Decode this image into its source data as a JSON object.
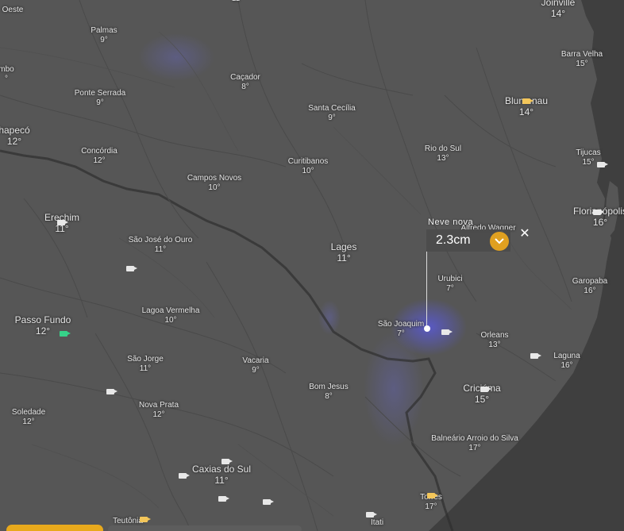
{
  "cities": [
    {
      "id": "oeste",
      "name": "Oeste",
      "temp": ""
    },
    {
      "id": "top-partial",
      "name": "",
      "temp": "11"
    },
    {
      "id": "joinville",
      "name": "Joinville",
      "temp": "14°"
    },
    {
      "id": "palmas",
      "name": "Palmas",
      "temp": "9°"
    },
    {
      "id": "xanxere-partial",
      "name": "mbo",
      "temp": "°"
    },
    {
      "id": "cacador",
      "name": "Caçador",
      "temp": "8°"
    },
    {
      "id": "barra-velha",
      "name": "Barra Velha",
      "temp": "15°"
    },
    {
      "id": "ponte-serrada",
      "name": "Ponte Serrada",
      "temp": "9°"
    },
    {
      "id": "blumenau",
      "name": "Blumenau",
      "temp": "14°"
    },
    {
      "id": "santa-cecilia",
      "name": "Santa Cecília",
      "temp": "9°"
    },
    {
      "id": "chapeco",
      "name": "hapecó",
      "temp": "12°"
    },
    {
      "id": "concordia",
      "name": "Concórdia",
      "temp": "12°"
    },
    {
      "id": "rio-do-sul",
      "name": "Rio do Sul",
      "temp": "13°"
    },
    {
      "id": "tijucas",
      "name": "Tijucas",
      "temp": "15°"
    },
    {
      "id": "curitibanos",
      "name": "Curitibanos",
      "temp": "10°"
    },
    {
      "id": "campos-novos",
      "name": "Campos Novos",
      "temp": "10°"
    },
    {
      "id": "florianopolis",
      "name": "Florianópolis",
      "temp": "16°"
    },
    {
      "id": "erechim",
      "name": "Erechim",
      "temp": "11°"
    },
    {
      "id": "alfredo-wagner",
      "name": "Alfredo Wagner",
      "temp": ""
    },
    {
      "id": "sao-jose-do-ouro",
      "name": "São José do Ouro",
      "temp": "11°"
    },
    {
      "id": "lages",
      "name": "Lages",
      "temp": "11°"
    },
    {
      "id": "urubici",
      "name": "Urubici",
      "temp": "7°"
    },
    {
      "id": "garopaba",
      "name": "Garopaba",
      "temp": "16°"
    },
    {
      "id": "lagoa-vermelha",
      "name": "Lagoa Vermelha",
      "temp": "10°"
    },
    {
      "id": "passo-fundo",
      "name": "Passo Fundo",
      "temp": "12°"
    },
    {
      "id": "sao-joaquim",
      "name": "São Joaquim",
      "temp": "7°"
    },
    {
      "id": "orleans",
      "name": "Orleans",
      "temp": "13°"
    },
    {
      "id": "laguna",
      "name": "Laguna",
      "temp": "16°"
    },
    {
      "id": "sao-jorge",
      "name": "São Jorge",
      "temp": "11°"
    },
    {
      "id": "vacaria",
      "name": "Vacaria",
      "temp": "9°"
    },
    {
      "id": "bom-jesus",
      "name": "Bom Jesus",
      "temp": "8°"
    },
    {
      "id": "criciuma",
      "name": "Criciúma",
      "temp": "15°"
    },
    {
      "id": "nova-prata",
      "name": "Nova Prata",
      "temp": "12°"
    },
    {
      "id": "soledade",
      "name": "Soledade",
      "temp": "12°"
    },
    {
      "id": "balneario-arroio",
      "name": "Balneário Arroio do Silva",
      "temp": "17°"
    },
    {
      "id": "caxias-do-sul",
      "name": "Caxias do Sul",
      "temp": "11°"
    },
    {
      "id": "torres",
      "name": "Torres",
      "temp": "17°"
    },
    {
      "id": "teutonia",
      "name": "Teutônia",
      "temp": ""
    },
    {
      "id": "itati",
      "name": "Itati",
      "temp": ""
    }
  ],
  "popup": {
    "title": "Neve nova",
    "value": "2.3cm",
    "close_symbol": "✕"
  },
  "colors": {
    "land": "#565656",
    "sea": "#3f3f3f",
    "snow": "#5a5ad8",
    "expand_button": "#e0a020",
    "cam_yellow": "#f3c65a",
    "cam_green": "#36d389"
  }
}
